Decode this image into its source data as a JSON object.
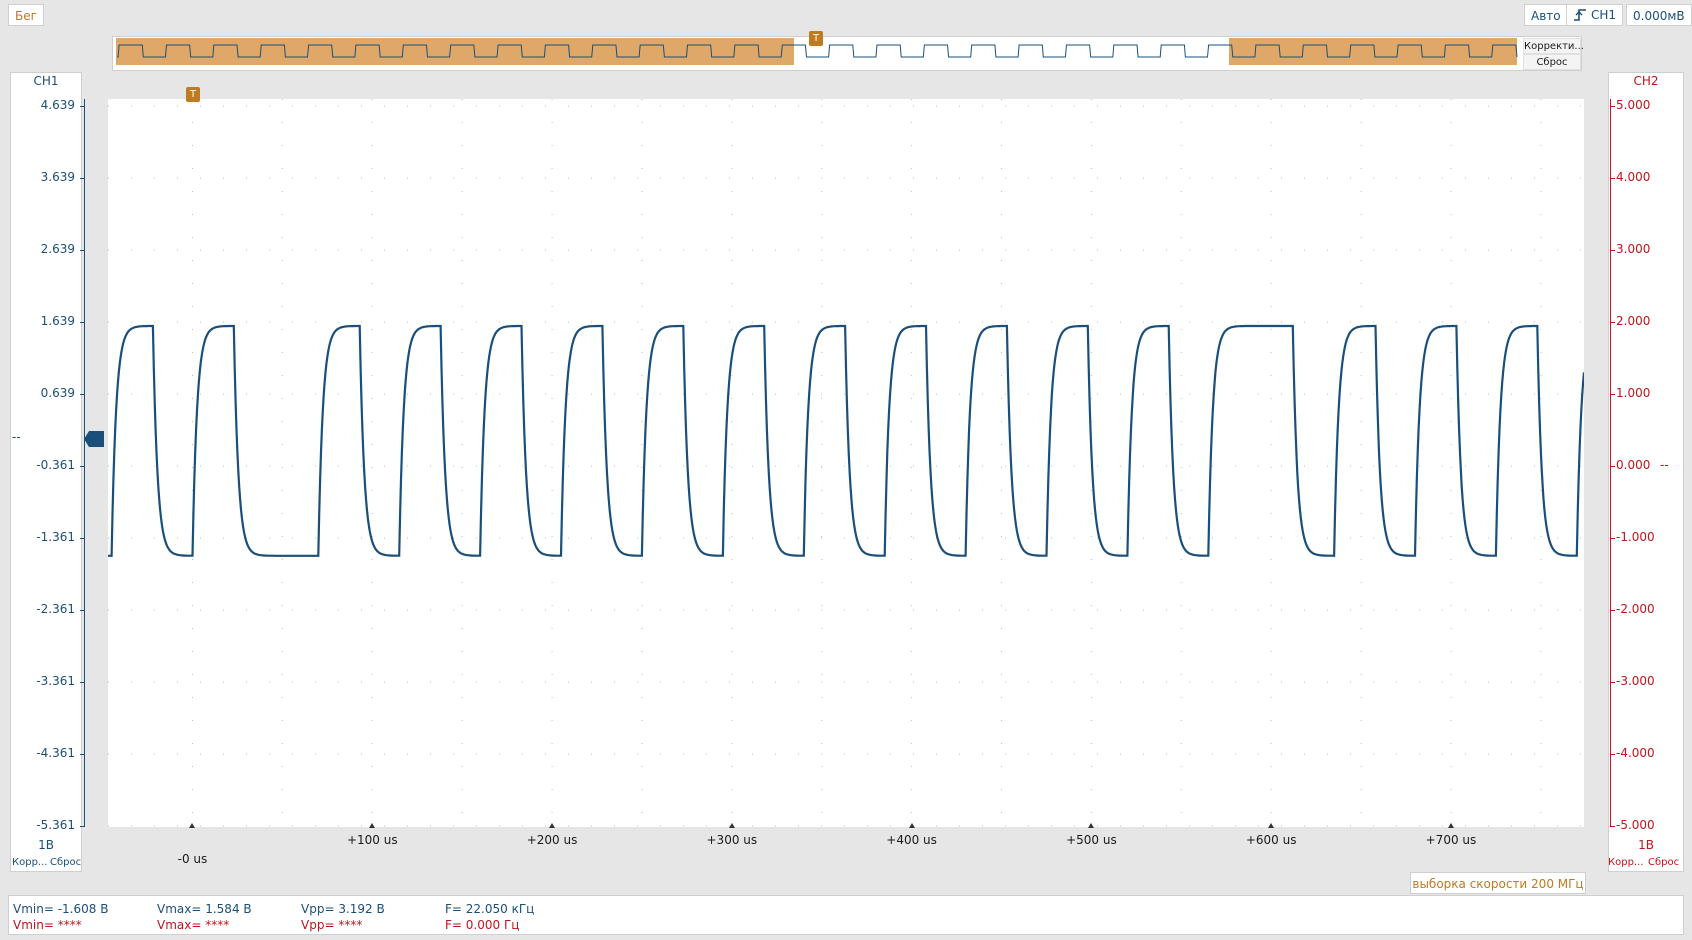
{
  "toolbar": {
    "run_label": "Бег",
    "mode_label": "Авто",
    "trigger_channel": "CH1",
    "trigger_level": "0.000мВ",
    "trigger_icon": "rising-edge-icon"
  },
  "overview": {
    "correct_label": "Корректи...",
    "reset_label": "Сброс",
    "trigger_marker": "T"
  },
  "plot": {
    "trigger_marker": "T",
    "ch1": {
      "title": "CH1",
      "scale": "1В",
      "correct_label": "Корр...",
      "reset_label": "Сброс",
      "ticks": [
        "4.639",
        "3.639",
        "2.639",
        "1.639",
        "0.639",
        "-0.361",
        "-1.361",
        "-2.361",
        "-3.361",
        "-4.361",
        "-5.361"
      ],
      "marker_label": "--"
    },
    "ch2": {
      "title": "CH2",
      "scale": "1В",
      "correct_label": "Корр...",
      "reset_label": "Сброс",
      "ticks": [
        "5.000",
        "4.000",
        "3.000",
        "2.000",
        "1.000",
        "0.000",
        "-1.000",
        "-2.000",
        "-3.000",
        "-4.000",
        "-5.000"
      ],
      "marker_label": "--"
    },
    "time_ticks": [
      "-0 us",
      "+100 us",
      "+200 us",
      "+300 us",
      "+400 us",
      "+500 us",
      "+600 us",
      "+700 us"
    ],
    "sample_rate_label": "выборка скорости 200 МГц"
  },
  "measurements": {
    "ch1": {
      "vmin": "Vmin= -1.608 В",
      "vmax": "Vmax= 1.584 В",
      "vpp": "Vpp= 3.192 В",
      "freq": "F= 22.050 кГц"
    },
    "ch2": {
      "vmin": "Vmin= ****",
      "vmax": "Vmax= ****",
      "vpp": "Vpp= ****",
      "freq": "F= 0.000 Гц"
    }
  },
  "colors": {
    "ch1": "#1b4f7a",
    "ch2": "#c0141c",
    "accent": "#c07a22",
    "overview_fill": "#e0a868"
  },
  "chart_data": {
    "type": "line",
    "title": "",
    "xlabel": "",
    "ylabel": "",
    "xlim": [
      -47,
      774
    ],
    "ylim": [
      -5.361,
      4.639
    ],
    "x_unit": "us",
    "y_unit": "V",
    "grid": true,
    "series": [
      {
        "name": "CH1",
        "waveform": "square",
        "high": 1.584,
        "low": -1.608,
        "rising_edges_us": [
          -45,
          0,
          70,
          115,
          160,
          205,
          250,
          295,
          340,
          385,
          430,
          475,
          520,
          565,
          635,
          680,
          725,
          770
        ],
        "falling_edges_us": [
          -22,
          23,
          93,
          138,
          183,
          228,
          273,
          318,
          363,
          408,
          453,
          498,
          543,
          612,
          658,
          703,
          748
        ]
      }
    ]
  }
}
